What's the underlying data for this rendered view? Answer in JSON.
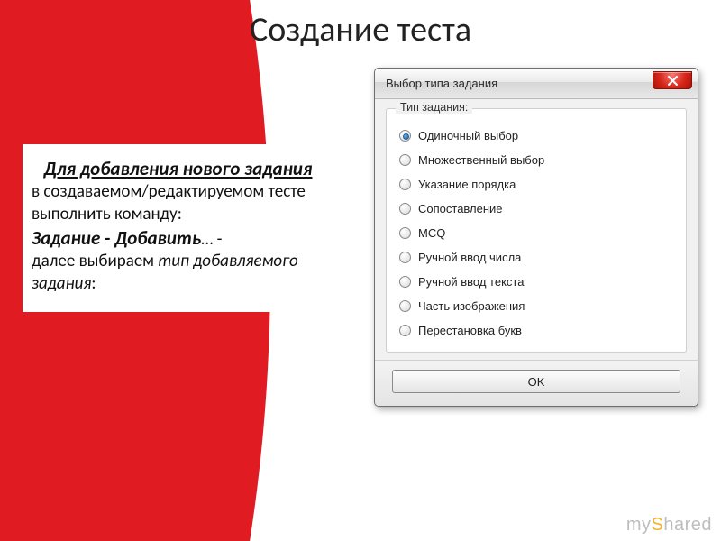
{
  "slide": {
    "title": "Создание теста",
    "text": {
      "heading": "Для добавления нового задания",
      "body1": "в создаваемом/редактируемом тесте выполнить команду:",
      "command": "Задание - Добавить",
      "ellipsis": "… -",
      "body2_prefix": "далее выбираем ",
      "body2_italic": "тип добавляемого задания",
      "body2_suffix": ":"
    }
  },
  "dialog": {
    "title": "Выбор типа задания",
    "group_label": "Тип задания:",
    "options": [
      "Одиночный выбор",
      "Множественный выбор",
      "Указание порядка",
      "Сопоставление",
      "MCQ",
      "Ручной ввод числа",
      "Ручной ввод текста",
      "Часть изображения",
      "Перестановка букв"
    ],
    "selected_index": 0,
    "ok_label": "OK"
  },
  "watermark": {
    "pre": "my",
    "accent": "S",
    "post": "hared"
  }
}
